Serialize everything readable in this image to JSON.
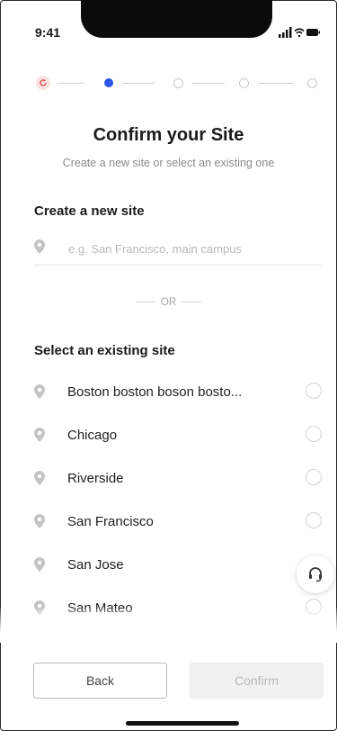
{
  "status_bar": {
    "time": "9:41"
  },
  "stepper": {
    "total_steps": 5,
    "current_step": 2,
    "completed_steps": 1
  },
  "header": {
    "title": "Confirm your Site",
    "subtitle": "Create a new site or select an existing one"
  },
  "create_section": {
    "heading": "Create a new site",
    "input_value": "",
    "input_placeholder": "e.g. San Francisco, main campus"
  },
  "divider": {
    "label": "OR"
  },
  "select_section": {
    "heading": "Select an existing site",
    "sites": [
      {
        "name": "Boston boston boson bosto..."
      },
      {
        "name": "Chicago"
      },
      {
        "name": "Riverside"
      },
      {
        "name": "San Francisco"
      },
      {
        "name": "San Jose"
      },
      {
        "name": "San Mateo"
      },
      {
        "name": ""
      }
    ]
  },
  "footer": {
    "back_label": "Back",
    "confirm_label": "Confirm"
  },
  "colors": {
    "accent": "#2a55e6",
    "completed_step_bg": "#fbe2e2",
    "completed_step_icon": "#e05a5a"
  }
}
